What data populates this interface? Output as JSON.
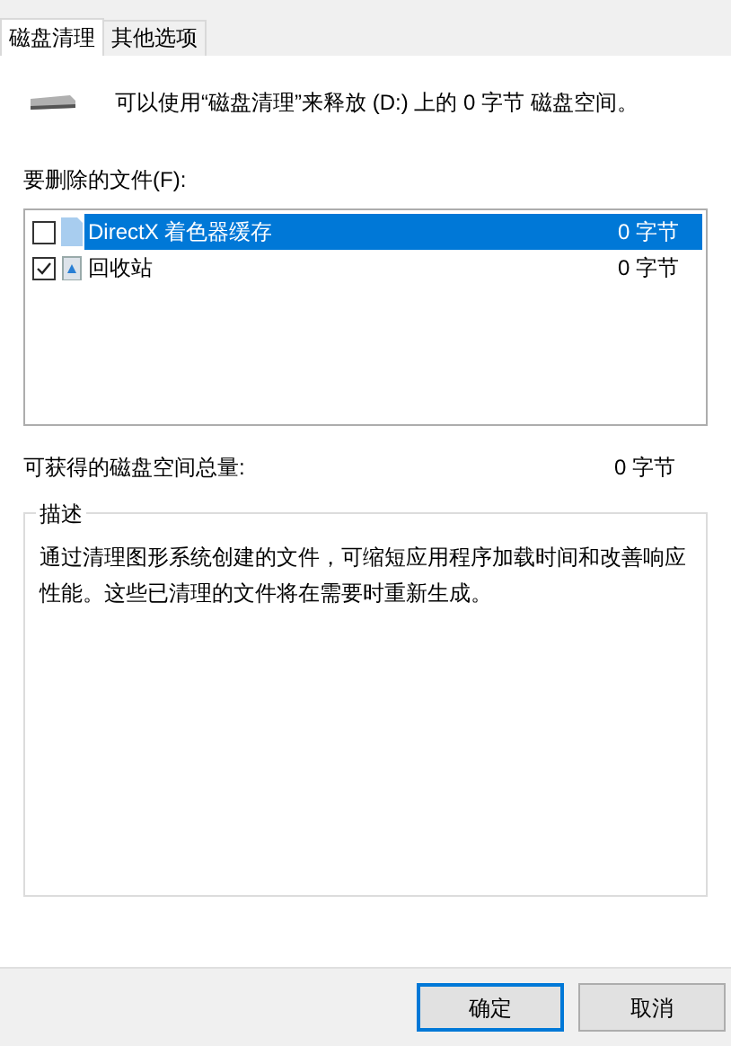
{
  "tabs": [
    {
      "label": "磁盘清理",
      "selected": true
    },
    {
      "label": "其他选项",
      "selected": false
    }
  ],
  "summary": "可以使用“磁盘清理”来释放  (D:) 上的 0 字节 磁盘空间。",
  "files_label": "要删除的文件(F):",
  "files": [
    {
      "name": "DirectX 着色器缓存",
      "size": "0 字节",
      "checked": false,
      "selected": true,
      "kind": "file"
    },
    {
      "name": "回收站",
      "size": "0 字节",
      "checked": true,
      "selected": false,
      "kind": "recycle"
    }
  ],
  "total_label": "可获得的磁盘空间总量:",
  "total_value": "0 字节",
  "description": {
    "title": "描述",
    "text": "通过清理图形系统创建的文件，可缩短应用程序加载时间和改善响应性能。这些已清理的文件将在需要时重新生成。"
  },
  "buttons": [
    {
      "label": "确定",
      "selected": true
    },
    {
      "label": "取消",
      "selected": false
    }
  ]
}
